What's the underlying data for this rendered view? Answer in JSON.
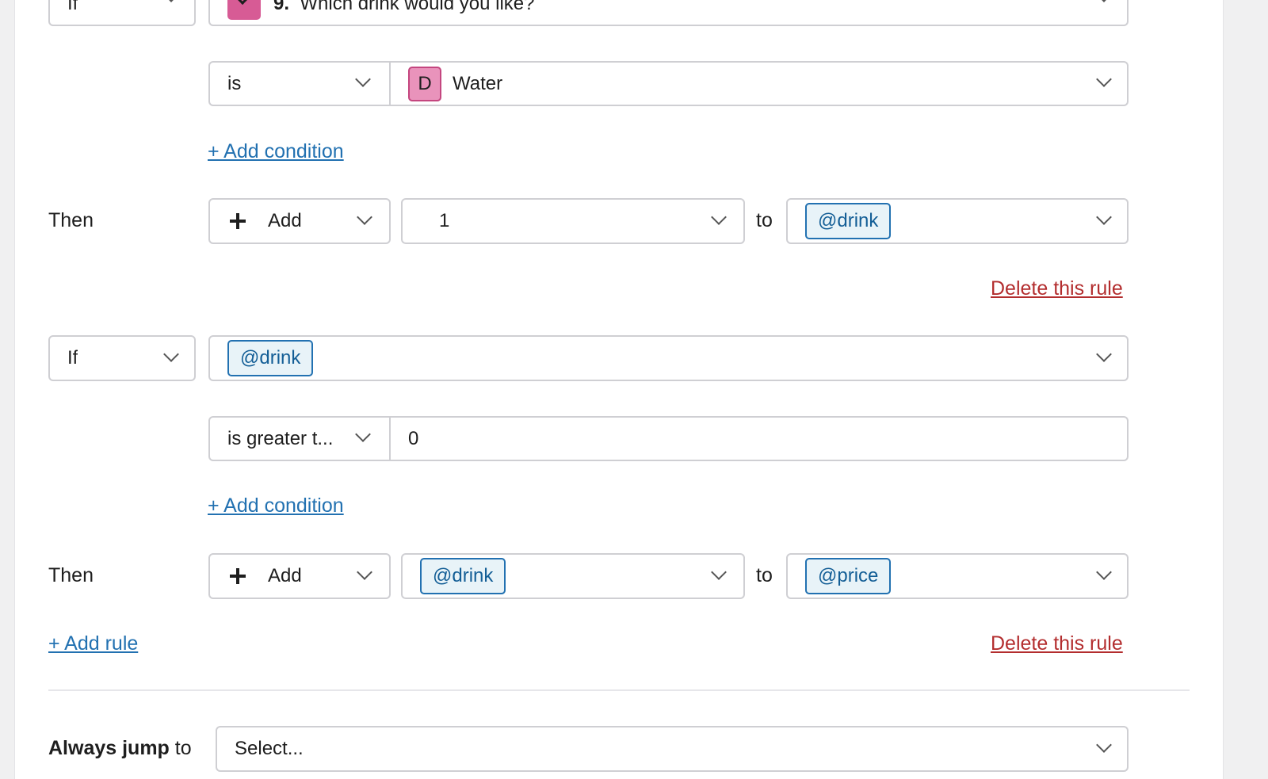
{
  "rule1": {
    "if_select": "If",
    "question_number": "9.",
    "question_text": "Which drink would you like?",
    "operator": "is",
    "answer_letter": "D",
    "answer_value": "Water",
    "add_condition": "+ Add condition",
    "then_label": "Then",
    "action": "Add",
    "amount": "1",
    "to_label": "to",
    "target_variable": "@drink",
    "delete_rule": "Delete this rule"
  },
  "rule2": {
    "if_select": "If",
    "variable": "@drink",
    "operator": "is greater t...",
    "value": "0",
    "add_condition": "+ Add condition",
    "then_label": "Then",
    "action": "Add",
    "amount_variable": "@drink",
    "to_label": "to",
    "target_variable": "@price",
    "delete_rule": "Delete this rule"
  },
  "add_rule": "+ Add rule",
  "always_jump": {
    "label_bold": "Always jump",
    "label_rest": " to",
    "placeholder": "Select..."
  },
  "colors": {
    "link": "#2271b1",
    "delete": "#b32d2e",
    "chip_bg": "#e8f3f8",
    "question_icon": "#d75b95"
  }
}
